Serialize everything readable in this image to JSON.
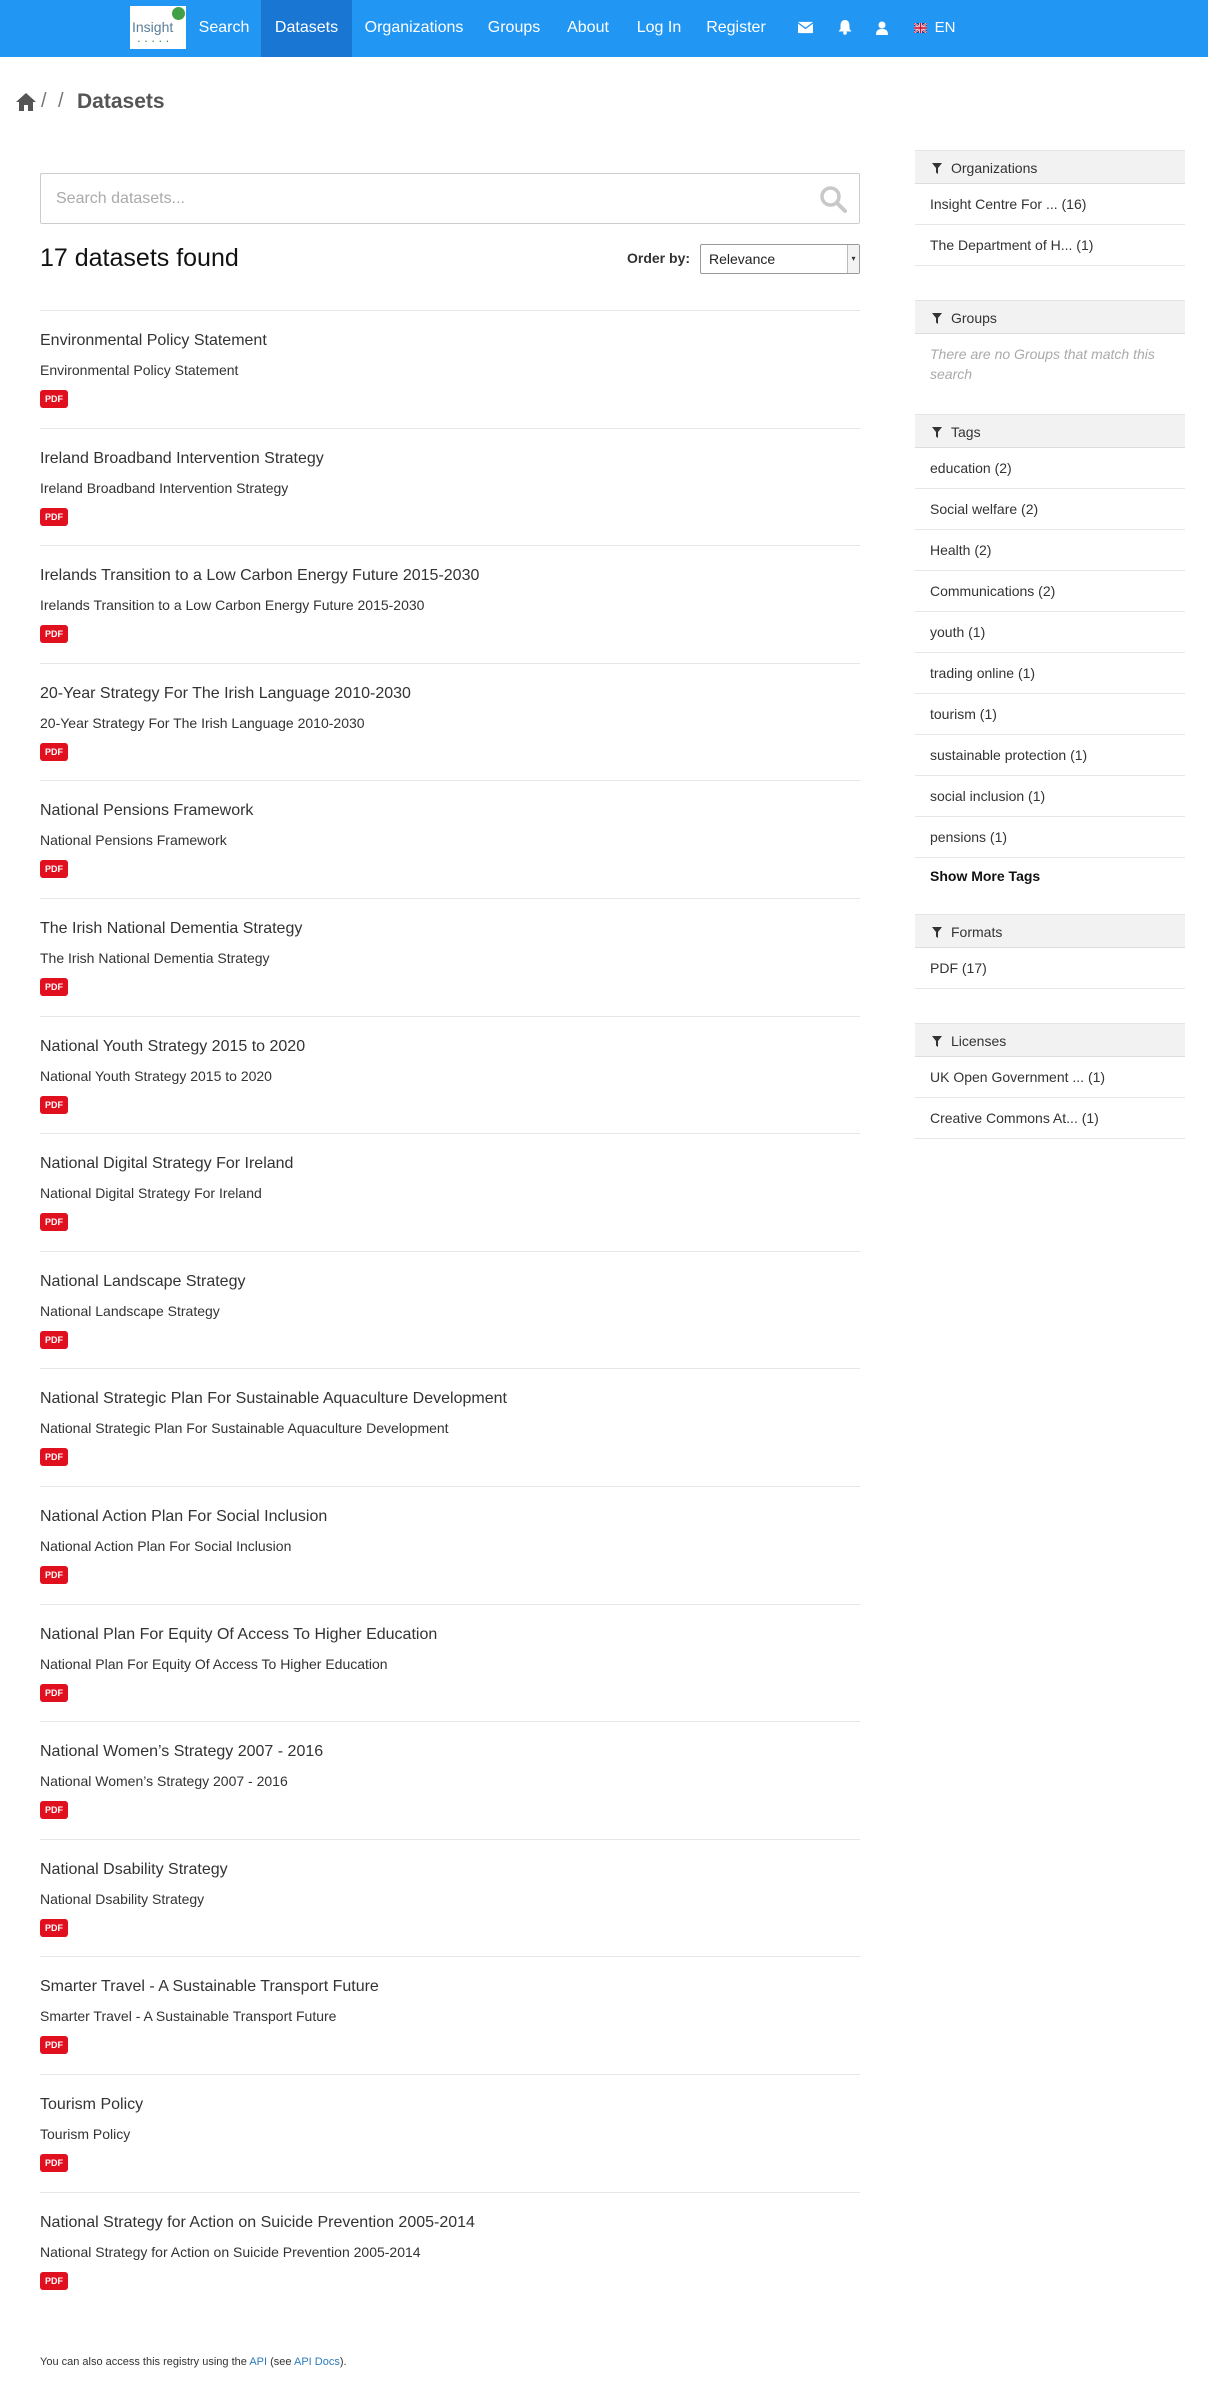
{
  "nav": {
    "logo_text": "Insight",
    "logo_sub": "• • • • •",
    "items": [
      "Search",
      "Datasets",
      "Organizations",
      "Groups",
      "About",
      "Log In",
      "Register"
    ],
    "active": "Datasets",
    "language": "EN",
    "icons": [
      "envelope-icon",
      "bell-icon",
      "user-icon",
      "uk-flag-icon"
    ]
  },
  "breadcrumb": {
    "home_icon": "home-icon",
    "sep1": "/",
    "sep2": "/",
    "title": "Datasets"
  },
  "search": {
    "placeholder": "Search datasets...",
    "icon": "search-icon"
  },
  "results": {
    "count_text": "17 datasets found",
    "order_label": "Order by:",
    "order_value": "Relevance"
  },
  "datasets": [
    {
      "title": "Environmental Policy Statement",
      "desc": "Environmental Policy Statement",
      "format": "PDF"
    },
    {
      "title": "Ireland Broadband Intervention Strategy",
      "desc": "Ireland Broadband Intervention Strategy",
      "format": "PDF"
    },
    {
      "title": "Irelands Transition to a Low Carbon Energy Future 2015-2030",
      "desc": "Irelands Transition to a Low Carbon Energy Future 2015-2030",
      "format": "PDF"
    },
    {
      "title": "20-Year Strategy For The Irish Language 2010-2030",
      "desc": "20-Year Strategy For The Irish Language 2010-2030",
      "format": "PDF"
    },
    {
      "title": "National Pensions Framework",
      "desc": "National Pensions Framework",
      "format": "PDF"
    },
    {
      "title": "The Irish National Dementia Strategy",
      "desc": "The Irish National Dementia Strategy",
      "format": "PDF"
    },
    {
      "title": "National Youth Strategy 2015 to 2020",
      "desc": "National Youth Strategy 2015 to 2020",
      "format": "PDF"
    },
    {
      "title": "National Digital Strategy For Ireland",
      "desc": "National Digital Strategy For Ireland",
      "format": "PDF"
    },
    {
      "title": "National Landscape Strategy",
      "desc": "National Landscape Strategy",
      "format": "PDF"
    },
    {
      "title": "National Strategic Plan For Sustainable Aquaculture Development",
      "desc": "National Strategic Plan For Sustainable Aquaculture Development",
      "format": "PDF"
    },
    {
      "title": "National Action Plan For Social Inclusion",
      "desc": "National Action Plan For Social Inclusion",
      "format": "PDF"
    },
    {
      "title": "National Plan For Equity Of Access To Higher Education",
      "desc": "National Plan For Equity Of Access To Higher Education",
      "format": "PDF"
    },
    {
      "title": "National Women’s Strategy 2007 - 2016",
      "desc": "National Women’s Strategy 2007 - 2016",
      "format": "PDF"
    },
    {
      "title": "National Dsability Strategy",
      "desc": "National Dsability Strategy",
      "format": "PDF"
    },
    {
      "title": "Smarter Travel - A Sustainable Transport Future",
      "desc": "Smarter Travel - A Sustainable Transport Future",
      "format": "PDF"
    },
    {
      "title": "Tourism Policy",
      "desc": "Tourism Policy",
      "format": "PDF"
    },
    {
      "title": "National Strategy for Action on Suicide Prevention 2005-2014",
      "desc": "National Strategy for Action on Suicide Prevention 2005-2014",
      "format": "PDF"
    }
  ],
  "footer": {
    "prefix": "You can also access this registry using the",
    "api": "API",
    "middle": "(see",
    "api_docs": "API Docs",
    "suffix": ")."
  },
  "sidebar": {
    "organizations": {
      "heading": "Organizations",
      "items": [
        "Insight Centre For ... (16)",
        "The Department of H... (1)"
      ]
    },
    "groups": {
      "heading": "Groups",
      "empty": "There are no Groups that match this search"
    },
    "tags": {
      "heading": "Tags",
      "items": [
        "education (2)",
        "Social welfare (2)",
        "Health (2)",
        "Communications (2)",
        "youth (1)",
        "trading online (1)",
        "tourism (1)",
        "sustainable protection (1)",
        "social inclusion (1)",
        "pensions (1)"
      ],
      "more": "Show More Tags"
    },
    "formats": {
      "heading": "Formats",
      "items": [
        "PDF (17)"
      ]
    },
    "licenses": {
      "heading": "Licenses",
      "items": [
        "UK Open Government ... (1)",
        "Creative Commons At... (1)"
      ]
    }
  },
  "colors": {
    "navbar": "#2196f3",
    "nav_active": "#1976d2",
    "badge_pdf": "#e0101f",
    "link": "#2a7bbf"
  }
}
